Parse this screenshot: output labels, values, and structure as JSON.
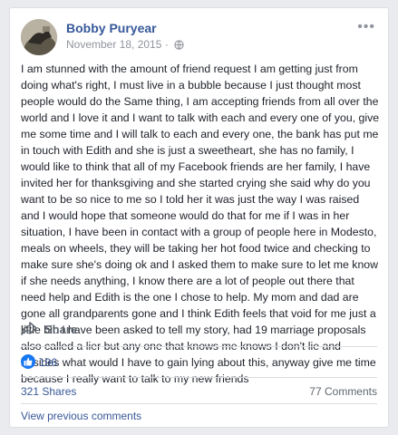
{
  "post": {
    "author": "Bobby Puryear",
    "date": "November 18, 2015",
    "separator": "·",
    "privacy_icon": "globe-icon",
    "more_icon": "more-options-icon",
    "text": "I am stunned with the amount of friend request I am getting just from doing what's right, I must live in a bubble because I just thought most people would do the Same thing, I am accepting friends from all over the world and I love it and I want to talk with each and every one of you, give me some time and I will talk to each and every one, the bank has put me in touch with Edith and she is just a sweetheart, she has no family, I would like to think that all of my Facebook friends are her family, I have invited her for thanksgiving and she started crying she said why do you want to be so nice to me so I told her it was just the way I was raised and I would hope that someone would do that for me if I was in her situation, I have been in contact with a group of people here in Modesto, meals on wheels, they will be taking her hot food twice and checking to make sure she's doing ok and I asked them to make sure to let me know if she needs anything, I know there are a lot of people out there that need help and Edith is the one I chose to help. My mom and dad are gone all grandparents gone and I think Edith feels that void for me just a little bit. I have been asked to tell my story, had 19 marriage proposals also called a lier but any one that knows me knows I don't lie and besides what would I have to gain lying about this, anyway give me time because I really want to talk to my new friends"
  },
  "actions": {
    "share_label": "Share",
    "share_icon": "share-arrow-icon"
  },
  "reactions": {
    "like_icon": "thumbs-up-icon",
    "like_count": "196"
  },
  "stats": {
    "shares": "321 Shares",
    "comments": "77 Comments"
  },
  "comments": {
    "view_previous": "View previous comments"
  },
  "colors": {
    "link_blue": "#385898",
    "author_blue": "#365899",
    "like_blue": "#1877f2",
    "muted_gray": "#90949c",
    "background": "#e9ebee"
  }
}
